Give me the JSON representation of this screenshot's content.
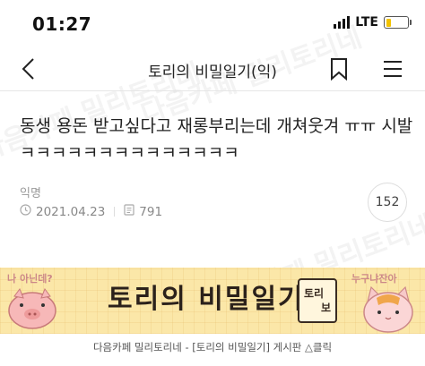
{
  "status_bar": {
    "time": "01:27",
    "network": "LTE",
    "battery_level": 0.25,
    "battery_color": "#f2c200"
  },
  "nav": {
    "title": "토리의 비밀일기(익)",
    "back_icon": "chevron-left-icon",
    "bookmark_icon": "bookmark-icon",
    "menu_icon": "hamburger-menu-icon"
  },
  "post": {
    "title": "동생 용돈 받고싶다고 재롱부리는데 개쳐웃겨 ㅠㅠ 시발 ㅋㅋㅋㅋㅋㅋㅋㅋㅋㅋㅋㅋㅋㅋ",
    "author": "익명",
    "date": "2021.04.23",
    "views": "791",
    "comment_count": "152"
  },
  "banner": {
    "title": "토리의 비밀일기",
    "speech_left": "나 아닌데?",
    "speech_right": "누구냐잔아",
    "stamp_char_1": "토리",
    "stamp_char_2": "보"
  },
  "footer_caption": "다음카페 밀리토리네 - [토리의 비밀일기] 게시판 △클릭",
  "watermark": "다음카페 밀리토리네",
  "colors": {
    "banner_bg": "#fbe7a8",
    "text_primary": "#222222",
    "text_muted": "#888888"
  }
}
